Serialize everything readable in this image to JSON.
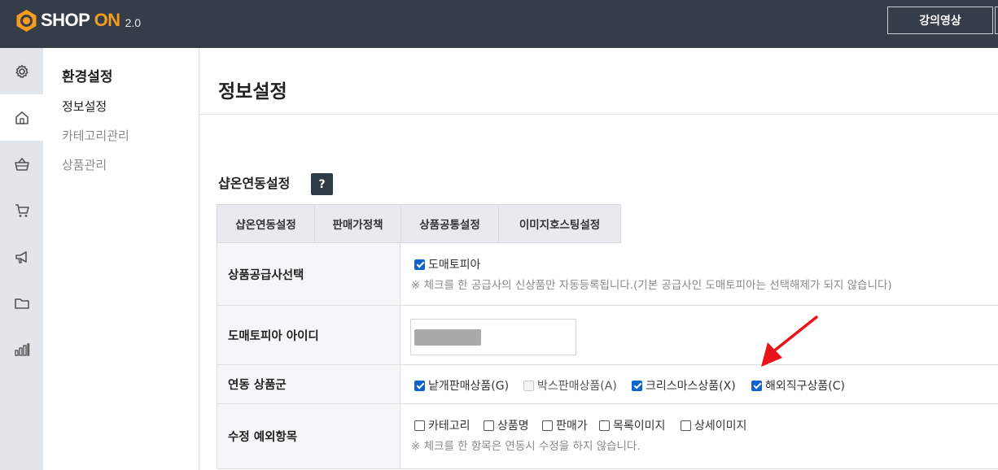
{
  "header": {
    "logo_text_1": "SHOP ",
    "logo_text_2": "ON",
    "logo_version": "2.0",
    "lecture_button": "강의영상"
  },
  "rail": {
    "icons": [
      "gear-icon",
      "home-icon",
      "basket-icon",
      "cart-icon",
      "megaphone-icon",
      "folder-icon",
      "bar-chart-icon"
    ],
    "active": "home-icon"
  },
  "submenu": {
    "title": "환경설정",
    "items": [
      {
        "label": "정보설정",
        "active": true
      },
      {
        "label": "카테고리관리",
        "active": false
      },
      {
        "label": "상품관리",
        "active": false
      }
    ]
  },
  "main": {
    "page_title": "정보설정",
    "section_title": "샵온연동설정",
    "help_label": "?",
    "tabs": [
      {
        "label": "샵온연동설정"
      },
      {
        "label": "판매가정책"
      },
      {
        "label": "상품공통설정"
      },
      {
        "label": "이미지호스팅설정"
      }
    ],
    "rows": {
      "supplier": {
        "label": "상품공급사선택",
        "option": {
          "label": "도매토피아",
          "checked": true
        },
        "note": "※ 체크를 한 공급사의 신상품만 자동등록됩니다.(기본 공급사인 도매토피아는 선택해제가 되지 않습니다)"
      },
      "account": {
        "label": "도매토피아 아이디"
      },
      "product_group": {
        "label": "연동 상품군",
        "options": [
          {
            "label": "낱개판매상품(G)",
            "checked": true,
            "disabled": false
          },
          {
            "label": "박스판매상품(A)",
            "checked": false,
            "disabled": true
          },
          {
            "label": "크리스마스상품(X)",
            "checked": true,
            "disabled": false
          },
          {
            "label": "해외직구상품(C)",
            "checked": true,
            "disabled": false
          }
        ]
      },
      "exceptions": {
        "label": "수정 예외항목",
        "options": [
          {
            "label": "카테고리",
            "checked": false
          },
          {
            "label": "상품명",
            "checked": false
          },
          {
            "label": "판매가",
            "checked": false
          },
          {
            "label": "목록이미지",
            "checked": false
          },
          {
            "label": "상세이미지",
            "checked": false
          }
        ],
        "note": "※ 체크를 한 항목은 연동시 수정을 하지 않습니다."
      }
    }
  },
  "colors": {
    "topbar": "#353d48",
    "brand_orange": "#f39c1e",
    "checkbox_blue": "#0b63ce",
    "annotation_red": "#e8141a"
  }
}
